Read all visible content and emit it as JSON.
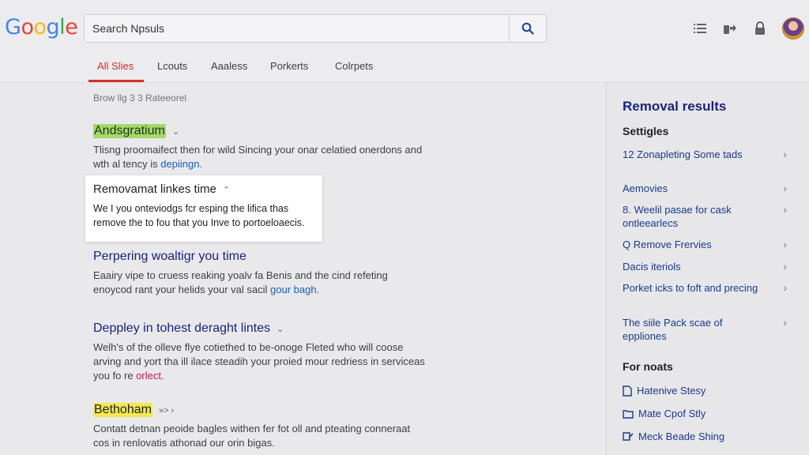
{
  "header": {
    "logo": [
      "G",
      "o",
      "o",
      "g",
      "l",
      "e"
    ],
    "logo_colors": [
      "#4285f4",
      "#ea4335",
      "#fbbc05",
      "#4285f4",
      "#34a853",
      "#ea4335"
    ],
    "search_value": "Search Npsuls",
    "icons": [
      "list-icon",
      "share-icon",
      "lock-icon",
      "avatar"
    ]
  },
  "tabs": [
    "All Slies",
    "Lcouts",
    "Aaaless",
    "Porkerts",
    "Colrpets"
  ],
  "main": {
    "result_stats": "Brow llg 3 3 Rateeorel",
    "results": [
      {
        "title": "Andsgratium",
        "arrow": "⌄",
        "snippet_a": "Tlisng proomaifect then for wild Sincing your onar celatied onerdons and wth al tency is ",
        "snippet_link": "depiingn."
      },
      {
        "title": "Removamat linkes time",
        "arrow": "⌃",
        "snippet_a": "We I you onteviodgs fcr esping the lifica thas remove the to fou that you Inve to portoeloaecis.",
        "snippet_link": ""
      },
      {
        "title": "Perpering woaltigr you time",
        "arrow": "",
        "snippet_a": "Eaairy vipe to cruess reaking yoalv fa Benis and the cind refeting enoycod rant your helids your val sacil ",
        "snippet_link": "gour bagh."
      },
      {
        "title": "Deppley in tohest deraght lintes",
        "arrow": "⌄",
        "snippet_a": "Welh's of the olleve flye cotiethed to be-onoge Fleted who will coose arving and yort tha ill ilace steadih your proied mour redriess in serviceas you fo re ",
        "snippet_link": "orlect."
      },
      {
        "title": "Bethoham",
        "arrow": "»> ›",
        "snippet_a": "Contatt detnan peoide bagles withen fer fot oll and pteating conneraat cos in renlovatis athonad our orin bigas.",
        "snippet_link": ""
      }
    ]
  },
  "sidebar": {
    "heading": "Removal results",
    "subheading": "Settigles",
    "items": [
      "12 Zonapleting Some tads",
      "Aemovies",
      "8. Weelil pasae for cask ontleearlecs",
      "Q Remove Frervies",
      "Dacis iteriols",
      "Porket icks to foft and precing",
      "The siile Pack scae of eppliones"
    ],
    "subheading2": "For noats",
    "links": [
      "Hatenive Stesy",
      "Mate Cpof Stly",
      "Meck Beade Shing"
    ]
  }
}
